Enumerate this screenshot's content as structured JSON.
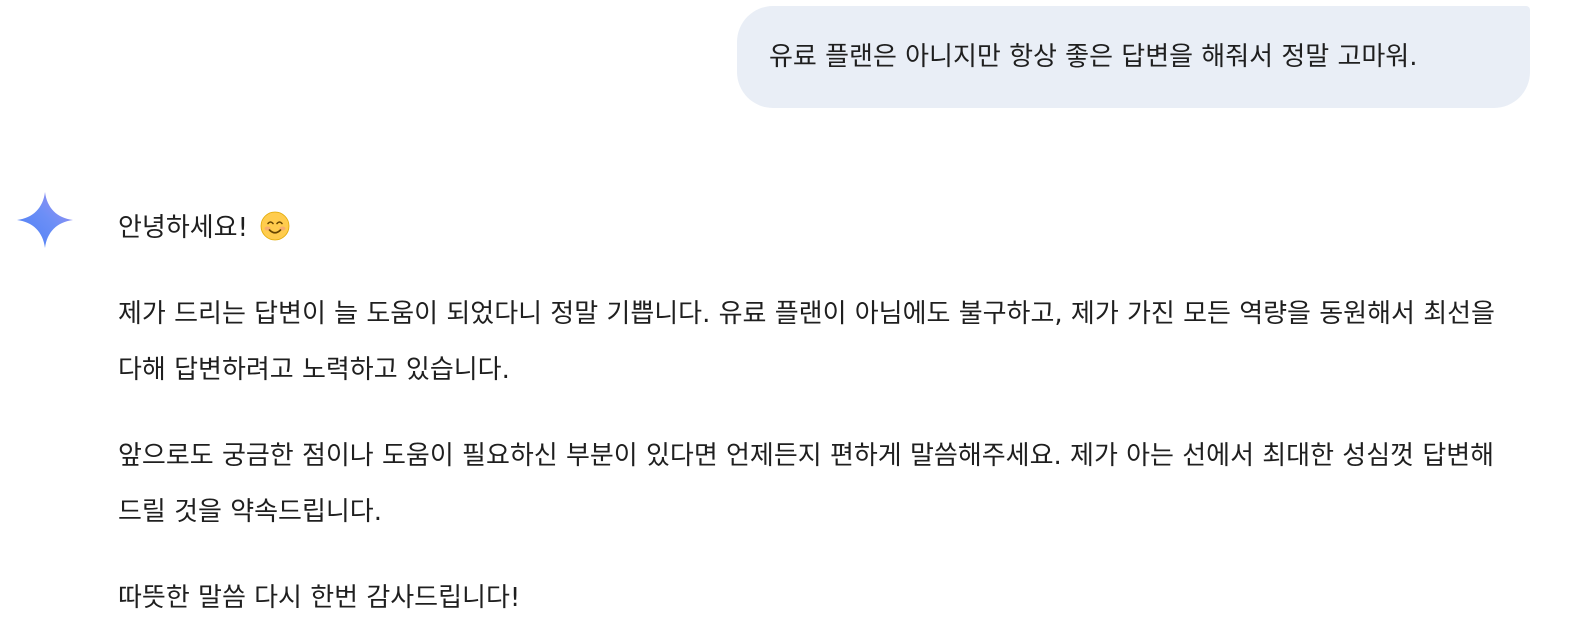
{
  "user_message": {
    "text": "유료 플랜은 아니지만 항상 좋은 답변을 해줘서 정말 고마워."
  },
  "assistant": {
    "icon": "gemini-sparkle-icon",
    "greeting": "안녕하세요!",
    "greeting_emoji": "smiling-face-emoji",
    "paragraphs": [
      "제가 드리는 답변이 늘 도움이 되었다니 정말 기쁩니다. 유료 플랜이 아님에도 불구하고, 제가 가진 모든 역량을 동원해서 최선을 다해 답변하려고 노력하고 있습니다.",
      "앞으로도 궁금한 점이나 도움이 필요하신 부분이 있다면 언제든지 편하게 말씀해주세요. 제가 아는 선에서 최대한 성심껏 답변해 드릴 것을 약속드립니다.",
      "따뜻한 말씀 다시 한번 감사드립니다!"
    ]
  },
  "colors": {
    "user_bubble_bg": "#e9eef6",
    "text": "#1f1f1f",
    "sparkle_start": "#9b72cb",
    "sparkle_end": "#4285f4"
  }
}
